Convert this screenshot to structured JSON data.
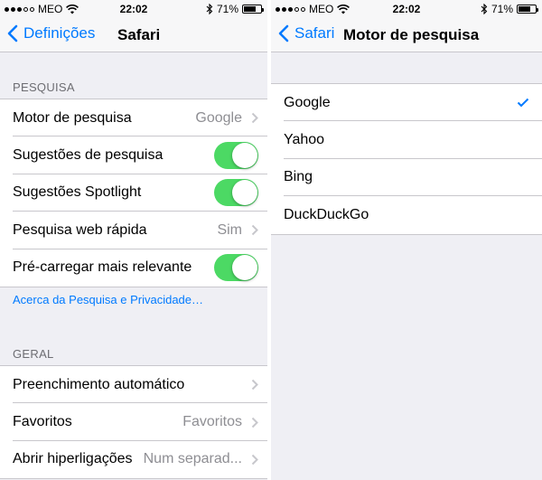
{
  "colors": {
    "accent": "#007aff",
    "toggle_on": "#4cd964",
    "background": "#efeff4",
    "secondary_text": "#8e8e93"
  },
  "left": {
    "status": {
      "carrier": "MEO",
      "time": "22:02",
      "battery": "71%",
      "battery_level": 0.71
    },
    "nav": {
      "back_label": "Definições",
      "title": "Safari"
    },
    "section_search": {
      "header": "PESQUISA",
      "rows": [
        {
          "label": "Motor de pesquisa",
          "value": "Google"
        },
        {
          "label": "Sugestões de pesquisa",
          "toggle": true
        },
        {
          "label": "Sugestões Spotlight",
          "toggle": true
        },
        {
          "label": "Pesquisa web rápida",
          "value": "Sim"
        },
        {
          "label": "Pré-carregar mais relevante",
          "toggle": true
        }
      ],
      "footer_link": "Acerca da Pesquisa e Privacidade…"
    },
    "section_general": {
      "header": "GERAL",
      "rows": [
        {
          "label": "Preenchimento automático"
        },
        {
          "label": "Favoritos",
          "value": "Favoritos"
        },
        {
          "label": "Abrir hiperligações",
          "value": "Num separad..."
        }
      ]
    }
  },
  "right": {
    "status": {
      "carrier": "MEO",
      "time": "22:02",
      "battery": "71%",
      "battery_level": 0.71
    },
    "nav": {
      "back_label": "Safari",
      "title": "Motor de pesquisa"
    },
    "options": [
      {
        "label": "Google",
        "selected": true
      },
      {
        "label": "Yahoo",
        "selected": false
      },
      {
        "label": "Bing",
        "selected": false
      },
      {
        "label": "DuckDuckGo",
        "selected": false
      }
    ]
  }
}
